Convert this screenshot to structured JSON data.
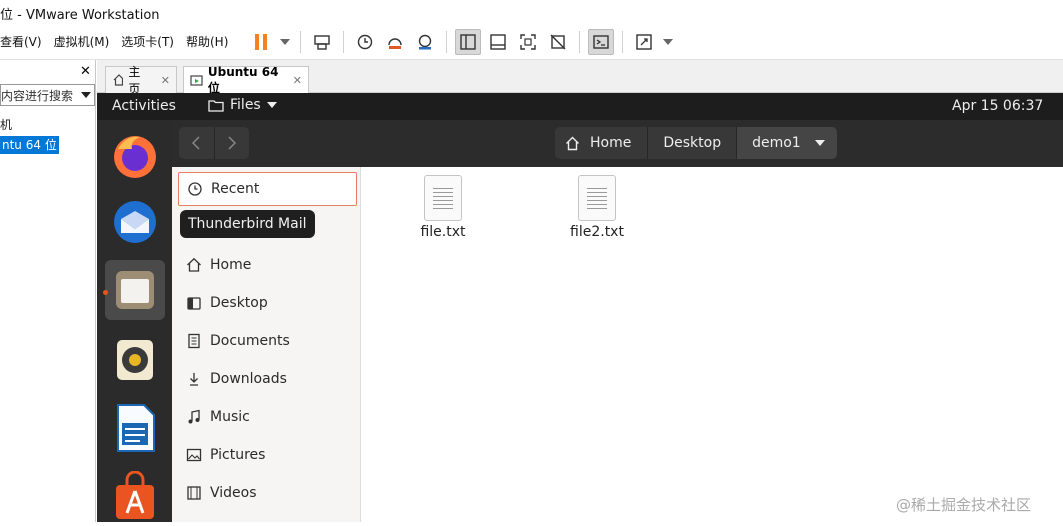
{
  "window": {
    "title": "位 - VMware Workstation"
  },
  "menubar": {
    "view": "查看(V)",
    "vm": "虚拟机(M)",
    "tabs": "选项卡(T)",
    "help": "帮助(H)"
  },
  "library": {
    "close": "✕",
    "search_placeholder": "内容进行搜索",
    "tree_root": "机",
    "tree_vm": "ntu 64 位"
  },
  "vm_tabs": {
    "home": "主页",
    "ubuntu": "Ubuntu 64 位",
    "close": "✕"
  },
  "topbar": {
    "activities": "Activities",
    "app_menu": "Files",
    "clock": "Apr 15  06:37"
  },
  "dock": {
    "tooltip": "Thunderbird Mail"
  },
  "pathbar": {
    "home": "Home",
    "desktop": "Desktop",
    "current": "demo1"
  },
  "places": [
    {
      "label": "Recent",
      "icon": "clock-icon"
    },
    {
      "label": "Home",
      "icon": "home-icon"
    },
    {
      "label": "Desktop",
      "icon": "desktop-icon"
    },
    {
      "label": "Documents",
      "icon": "document-icon"
    },
    {
      "label": "Downloads",
      "icon": "download-icon"
    },
    {
      "label": "Music",
      "icon": "music-icon"
    },
    {
      "label": "Pictures",
      "icon": "picture-icon"
    },
    {
      "label": "Videos",
      "icon": "video-icon"
    }
  ],
  "files": [
    {
      "name": "file.txt"
    },
    {
      "name": "file2.txt"
    }
  ],
  "watermark": "@稀土掘金技术社区",
  "colors": {
    "accent_orange": "#e95420",
    "selection_blue": "#0078d7",
    "pause_orange": "#f5811f",
    "topbar": "#1d1d1d",
    "dock": "#2b2b2b"
  }
}
